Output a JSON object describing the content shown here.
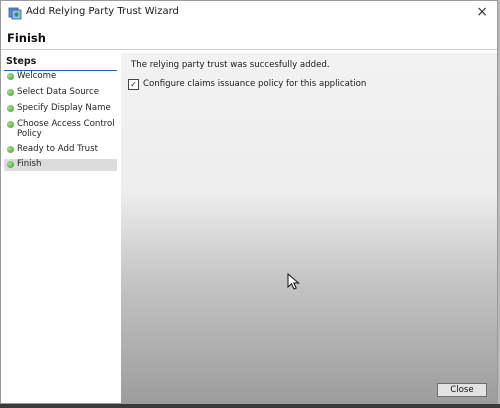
{
  "window": {
    "title": "Add Relying Party Trust Wizard",
    "heading": "Finish"
  },
  "steps": {
    "title": "Steps",
    "items": [
      {
        "label": "Welcome"
      },
      {
        "label": "Select Data Source"
      },
      {
        "label": "Specify Display Name"
      },
      {
        "label": "Choose Access Control Policy"
      },
      {
        "label": "Ready to Add Trust"
      },
      {
        "label": "Finish",
        "active": true
      }
    ]
  },
  "main": {
    "message": "The relying party trust was succesfully added.",
    "checkbox_label": "Configure claims issuance policy for this application",
    "checkbox_checked": true
  },
  "footer": {
    "close_label": "Close"
  },
  "icons": {
    "app": "adfs-wizard-icon",
    "step_status": "green-dot-icon",
    "cursor": "mouse-pointer-icon"
  },
  "colors": {
    "steps_underline": "#1a5ec2",
    "step_dot": "#3d9a2a",
    "active_step_bg": "#dcdcdc"
  }
}
